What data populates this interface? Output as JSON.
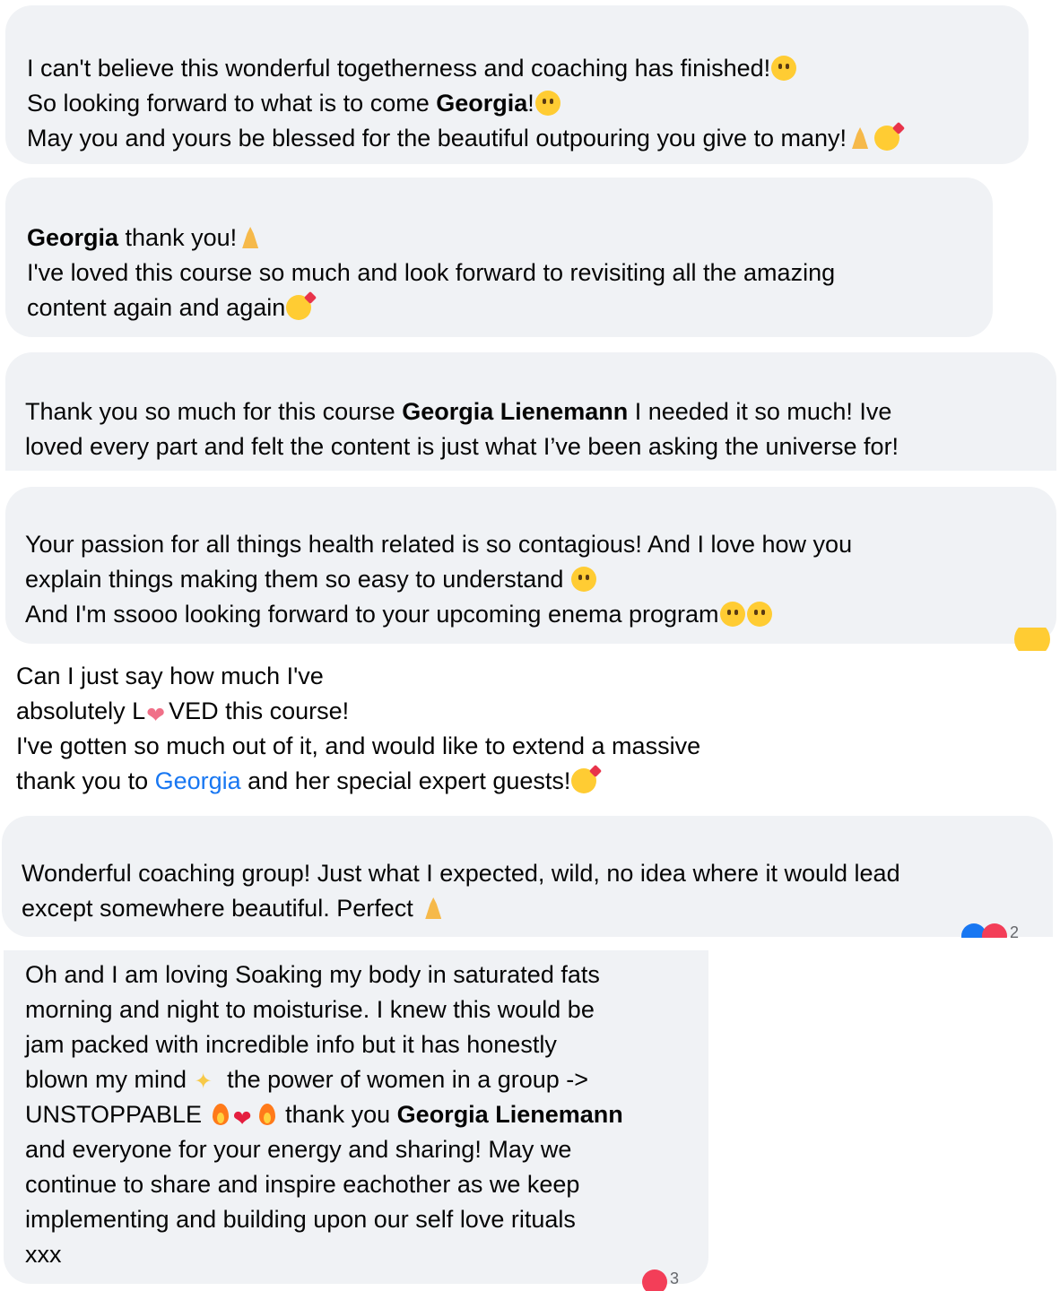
{
  "comments": [
    {
      "lines": [
        {
          "t1": "I can't believe this wonderful togetherness and coaching has finished!",
          "emoji": "crying-face"
        },
        {
          "t1": "So looking forward to what is to come ",
          "bold": "Georgia",
          "t2": "!",
          "emoji": "grinning-face"
        },
        {
          "t1": "May you and yours be blessed for the beautiful outpouring you give to many!",
          "emoji": "praying-hands",
          "emoji2": "smiling-face-with-hearts"
        }
      ]
    },
    {
      "lines": [
        {
          "bold": "Georgia",
          "t2": " thank you!",
          "emoji": "praying-hands"
        },
        {
          "t1": "I've loved this course so much and look forward to revisiting all the amazing"
        },
        {
          "t1": "content again and again",
          "emoji": "smiling-face-with-hearts"
        }
      ]
    },
    {
      "lines": [
        {
          "t1": "Thank you so much for this course ",
          "bold": "Georgia Lienemann",
          "t2": " I needed it so much! Ive"
        },
        {
          "t1": "loved every part and felt the content is just what I’ve been asking the universe for!"
        }
      ]
    },
    {
      "lines": [
        {
          "t1": "Your passion for all things health related is so contagious! And I love how you"
        },
        {
          "t1": "explain things making them so easy to understand ",
          "emoji": "grinning-face"
        },
        {
          "t1": "And I'm ssooo looking forward to your upcoming enema program",
          "emoji": "winking-face-with-tongue",
          "emoji2": "face-with-tears-of-joy"
        }
      ],
      "reaction": "haha-reaction"
    },
    {
      "lines": [
        {
          "t1": "Can I just say how much I've"
        },
        {
          "t1": "absolutely L",
          "t2": "VED this course!"
        },
        {
          "t1": "I've gotten so much out of it, and would like to extend a massive"
        },
        {
          "t1": "thank you to ",
          "link": "Georgia",
          "t2": " and her special expert guests!"
        }
      ]
    },
    {
      "lines": [
        {
          "t1": "Wonderful coaching group! Just what I expected, wild, no idea where it would lead"
        },
        {
          "t1": "except somewhere beautiful. Perfect "
        }
      ],
      "reaction_count": "2"
    },
    {
      "lines": [
        {
          "t1": "Oh and I am loving Soaking my body in saturated fats"
        },
        {
          "t1": "morning and night to moisturise. I knew this would be"
        },
        {
          "t1": "jam packed with incredible info but it has honestly"
        },
        {
          "t1": "blown my mind ",
          "t2": " the power of women in a group ->"
        },
        {
          "t1": "UNSTOPPABLE ",
          "t2": " thank you ",
          "bold": "Georgia Lienemann"
        },
        {
          "t1": "and everyone for your energy and sharing! May we"
        },
        {
          "t1": "continue to share and inspire eachother as we keep"
        },
        {
          "t1": "implementing and building upon our self love rituals"
        },
        {
          "t1": "xxx"
        }
      ],
      "reaction_count": "3"
    }
  ]
}
